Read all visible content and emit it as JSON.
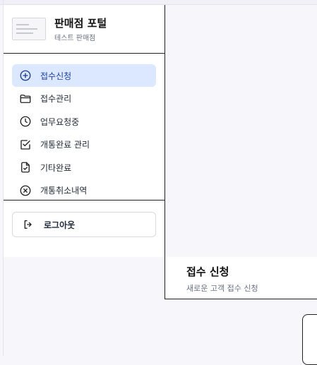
{
  "brand": {
    "title": "판매점 포털",
    "subtitle": "테스트 판매점",
    "logo_icon": "store-logo-image"
  },
  "nav": {
    "items": [
      {
        "label": "접수신청",
        "icon": "plus-circle-icon",
        "active": true
      },
      {
        "label": "접수관리",
        "icon": "folder-icon",
        "active": false
      },
      {
        "label": "업무요청중",
        "icon": "clock-icon",
        "active": false
      },
      {
        "label": "개통완료 관리",
        "icon": "check-square-icon",
        "active": false
      },
      {
        "label": "기타완료",
        "icon": "file-check-icon",
        "active": false
      },
      {
        "label": "개통취소내역",
        "icon": "x-circle-icon",
        "active": false
      }
    ]
  },
  "logout": {
    "label": "로그아웃",
    "icon": "logout-icon"
  },
  "page": {
    "title": "접수 신청",
    "subtitle": "새로운 고객 접수 신청"
  },
  "colors": {
    "accent": "#dbe8ff",
    "accent_text": "#1e40af",
    "border": "#222222"
  }
}
